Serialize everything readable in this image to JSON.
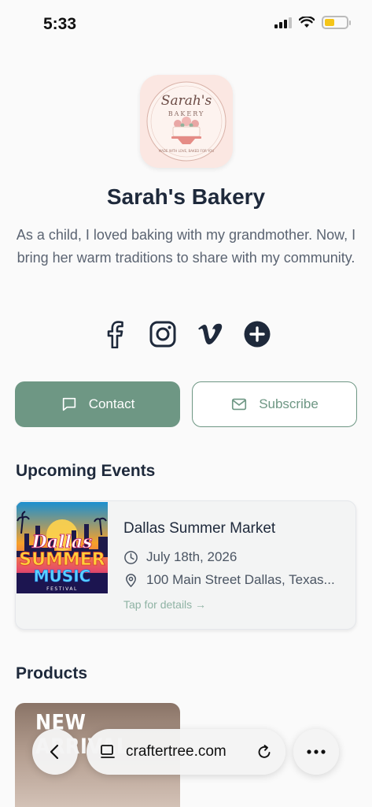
{
  "status_bar": {
    "time": "5:33"
  },
  "profile": {
    "logo_text": {
      "script": "Sarah's",
      "sub": "BAKERY",
      "ring": "MADE WITH LOVE, BAKED FOR YOU"
    },
    "name": "Sarah's Bakery",
    "bio": "As a child, I loved baking with my grandmother. Now, I bring her warm traditions to share with my community."
  },
  "socials": [
    {
      "icon": "facebook-icon"
    },
    {
      "icon": "instagram-icon"
    },
    {
      "icon": "vimeo-icon"
    },
    {
      "icon": "plus-circle-icon"
    }
  ],
  "actions": {
    "contact_label": "Contact",
    "subscribe_label": "Subscribe"
  },
  "events": {
    "title": "Upcoming Events",
    "items": [
      {
        "poster_text": {
          "line1": "Dallas",
          "line2": "SUMMER",
          "line3": "MUSIC",
          "line4": "FESTIVAL"
        },
        "name": "Dallas Summer Market",
        "date": "July 18th, 2026",
        "location": "100 Main Street Dallas, Texas...",
        "tap": "Tap for details →"
      }
    ]
  },
  "products": {
    "title": "Products",
    "items": [
      {
        "tag": "NEW ARRIVAL"
      }
    ]
  },
  "browser": {
    "url": "craftertree.com"
  },
  "colors": {
    "accent": "#6e9784",
    "heading": "#1e293b"
  }
}
